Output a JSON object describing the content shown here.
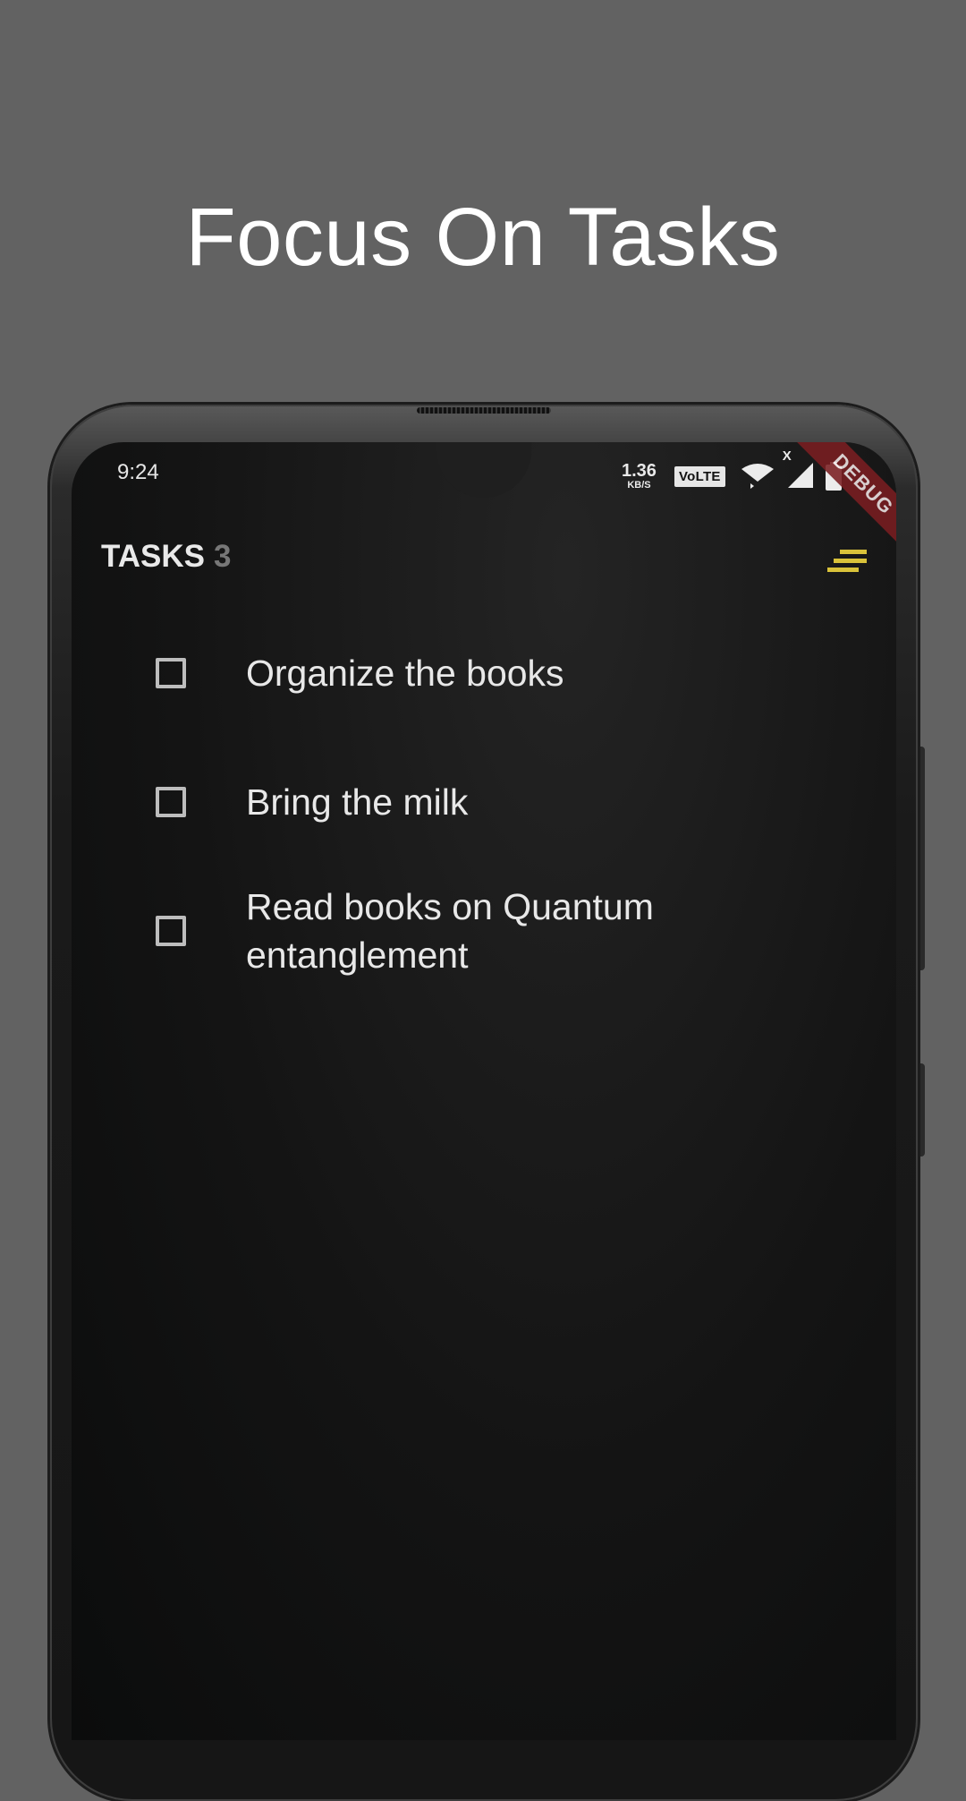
{
  "headline": "Focus On Tasks",
  "status_bar": {
    "time": "9:24",
    "net_speed_value": "1.36",
    "net_speed_unit": "KB/S",
    "volte": "VoLTE",
    "signal_label": "X",
    "icons": [
      "wifi-icon",
      "signal-icon",
      "battery-icon"
    ]
  },
  "debug_banner": "DEBUG",
  "header": {
    "title": "TASKS",
    "count": "3",
    "menu_icon": "sort-menu-icon"
  },
  "tasks": [
    {
      "label": "Organize the books",
      "checked": false
    },
    {
      "label": "Bring the milk",
      "checked": false
    },
    {
      "label": "Read books on Quantum entanglement",
      "checked": false
    }
  ],
  "colors": {
    "background": "#626262",
    "screen": "#141414",
    "accent": "#d9c23a",
    "text": "#e8e8e8",
    "count": "#777777",
    "debug_banner": "#7a1e22"
  }
}
